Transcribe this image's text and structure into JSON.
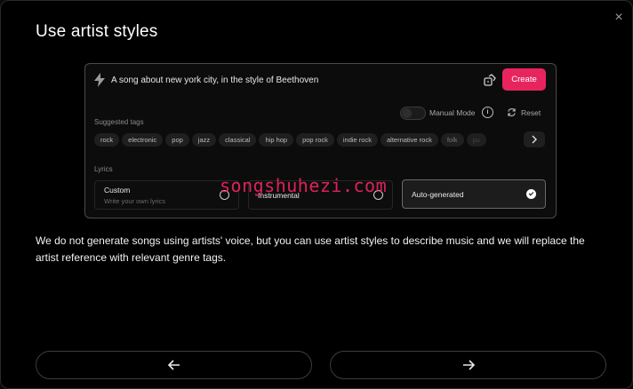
{
  "modal": {
    "title": "Use artist styles",
    "close_symbol": "×",
    "description": "We do not generate songs using artists' voice, but you can use artist styles to describe music and we will replace the artist reference with relevant genre tags."
  },
  "demo": {
    "prompt": "A song about new york city, in the style of Beethoven",
    "create_label": "Create",
    "suggested_tags_label": "Suggested tags",
    "manual_mode_label": "Manual Mode",
    "manual_mode_on": false,
    "reset_label": "Reset",
    "tags": [
      "rock",
      "electronic",
      "pop",
      "jazz",
      "classical",
      "hip hop",
      "pop rock",
      "indie rock",
      "alternative rock",
      "folk",
      "pu"
    ],
    "lyrics_label": "Lyrics",
    "lyrics_options": [
      {
        "title": "Custom",
        "subtitle": "Write your own lyrics",
        "selected": false
      },
      {
        "title": "Instrumental",
        "subtitle": "",
        "selected": false
      },
      {
        "title": "Auto-generated",
        "subtitle": "",
        "selected": true
      }
    ]
  },
  "icons": {
    "bolt": "bolt-icon",
    "dice": "dice-icon",
    "info": "info-icon",
    "reset": "refresh-icon",
    "next_tags": "chevron-right-icon",
    "prev": "arrow-left-icon",
    "next": "arrow-right-icon",
    "close": "close-icon"
  },
  "colors": {
    "accent": "#e8245f",
    "background": "#000000"
  },
  "watermark": "songshuhezi.com"
}
